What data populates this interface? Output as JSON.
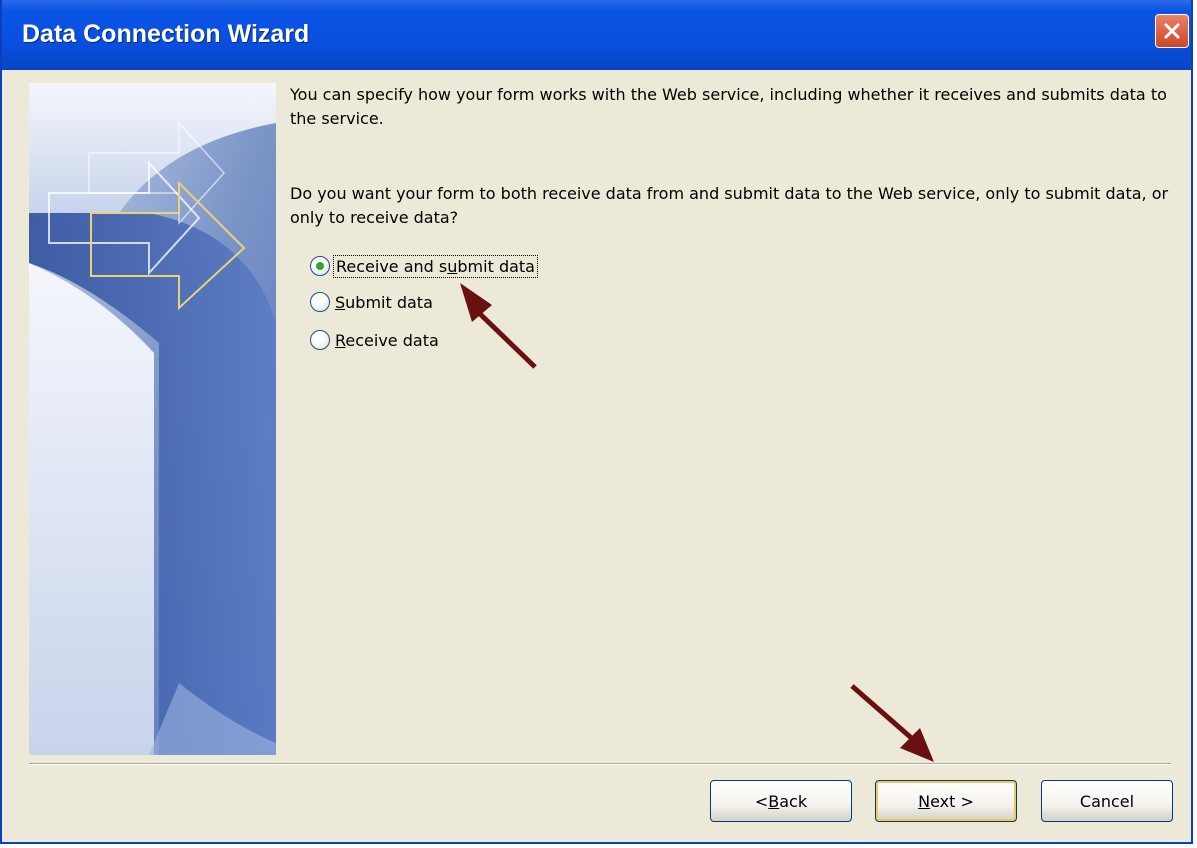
{
  "window": {
    "title": "Data Connection Wizard",
    "close_icon": "close-icon"
  },
  "main": {
    "intro": "You can specify how your form works with the Web service, including whether it receives and submits data to the service.",
    "question": "Do you want your form to both receive data from and submit data to the Web service, only to submit data, or only to receive data?",
    "options": [
      {
        "label_pre": "Receive and s",
        "accel": "u",
        "label_post": "bmit data",
        "selected": true
      },
      {
        "label_pre": "",
        "accel": "S",
        "label_post": "ubmit data",
        "selected": false
      },
      {
        "label_pre": "",
        "accel": "R",
        "label_post": "eceive data",
        "selected": false
      }
    ]
  },
  "buttons": {
    "back": {
      "pre": "< ",
      "accel": "B",
      "post": "ack"
    },
    "next": {
      "pre": "",
      "accel": "N",
      "post": "ext >"
    },
    "cancel": "Cancel"
  },
  "colors": {
    "titlebar": "#0b55e6",
    "dialog_bg": "#ece9d8",
    "annotation_arrow": "#6b1010"
  }
}
